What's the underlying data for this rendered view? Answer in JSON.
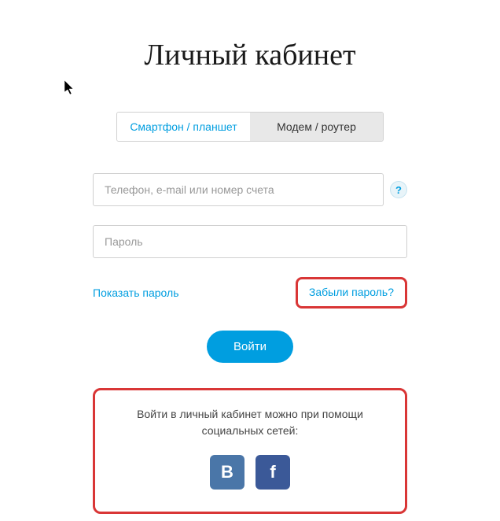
{
  "title": "Личный кабинет",
  "tabs": {
    "smartphone": "Смартфон / планшет",
    "modem": "Модем / роутер"
  },
  "inputs": {
    "login_placeholder": "Телефон, e-mail или номер счета",
    "password_placeholder": "Пароль"
  },
  "help_icon": "?",
  "links": {
    "show_password": "Показать пароль",
    "forgot_password": "Забыли пароль?"
  },
  "login_button": "Войти",
  "social": {
    "text_line1": "Войти в личный кабинет можно при помощи",
    "text_line2": "социальных сетей:",
    "vk_label": "В",
    "fb_label": "f"
  }
}
